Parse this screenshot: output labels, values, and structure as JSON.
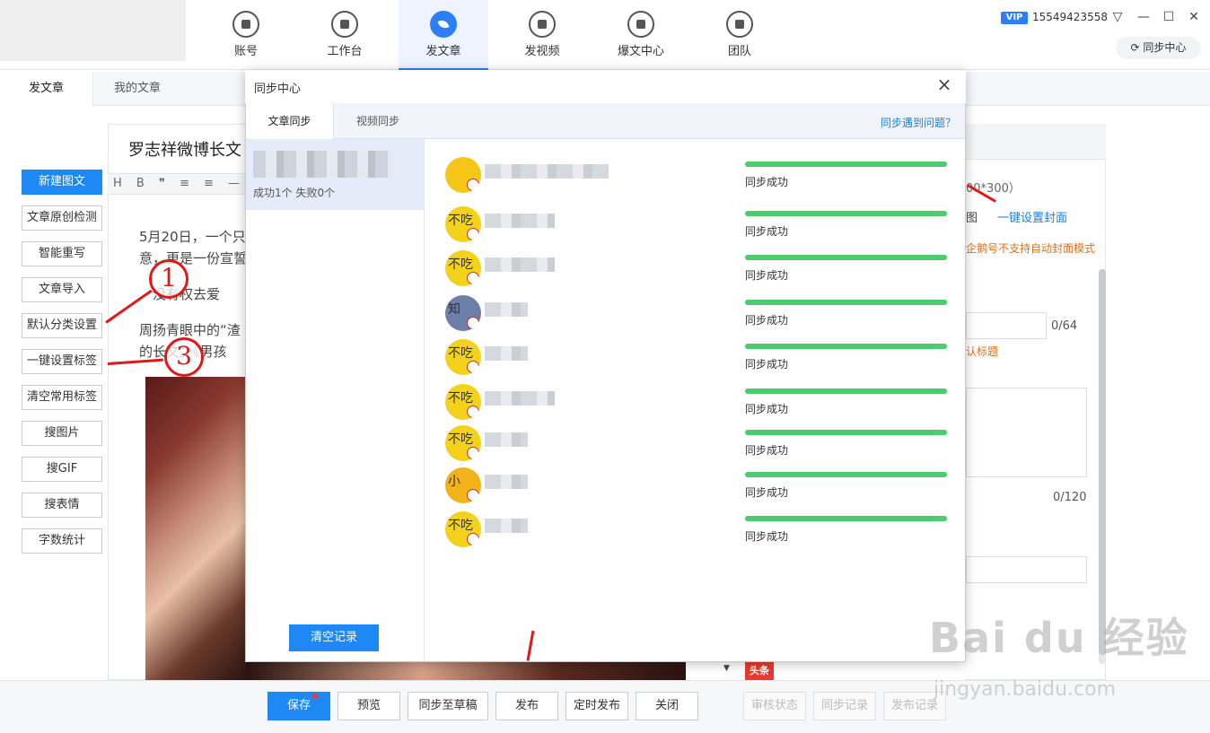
{
  "nav": {
    "items": [
      {
        "label": "账号",
        "icon": "account-icon"
      },
      {
        "label": "工作台",
        "icon": "monitor-icon"
      },
      {
        "label": "发文章",
        "icon": "feather-icon"
      },
      {
        "label": "发视频",
        "icon": "play-icon"
      },
      {
        "label": "爆文中心",
        "icon": "fire-icon"
      },
      {
        "label": "团队",
        "icon": "team-icon"
      }
    ],
    "active": "发文章"
  },
  "user": {
    "vip": "VIP",
    "phone": "15549423558",
    "sync_center": "同步中心"
  },
  "page_tabs": [
    "发文章",
    "我的文章"
  ],
  "tools": [
    "新建图文",
    "文章原创检测",
    "智能重写",
    "文章导入",
    "默认分类设置",
    "一键设置标签",
    "清空常用标签",
    "搜图片",
    "搜GIF",
    "搜表情",
    "字数统计"
  ],
  "editor": {
    "title": "罗志祥微博长文",
    "toolbar": "H B ❞ ≡ ≡ —",
    "paragraphs": [
      "5月20日，一个只",
      "意，更是一份宣誓",
      "没有权去爱",
      "周扬青眼中的“渣",
      "的长文。《男孩"
    ]
  },
  "right_panel": {
    "cover_size": "00*300）",
    "image_label": "图",
    "cover_link": "一键设置封面",
    "cover_tip": "企鹅号不支持自动封面模式",
    "title_count": "0/64",
    "title_tip": "认标题",
    "abstract_count": "0/120"
  },
  "bottom": {
    "buttons": [
      "保存",
      "预览",
      "同步至草稿",
      "发布",
      "定时发布",
      "关闭"
    ],
    "disabled_buttons": [
      "审核状态",
      "同步记录",
      "发布记录"
    ],
    "platform_badge": "头条"
  },
  "modal": {
    "title": "同步中心",
    "close": "×",
    "tabs": [
      "文章同步",
      "视频同步"
    ],
    "help_link": "同步遇到问题？",
    "record_stat": "成功1个 失败0个",
    "clear_button": "清空记录",
    "rows": [
      {
        "avatar_text": "",
        "avatar_color": "#f5c518",
        "status": "同步成功",
        "progress": 1.0
      },
      {
        "avatar_text": "不吃",
        "avatar_color": "#f4d21c",
        "status": "同步成功",
        "progress": 1.0
      },
      {
        "avatar_text": "不吃",
        "avatar_color": "#f4d21c",
        "status": "同步成功",
        "progress": 1.0
      },
      {
        "avatar_text": "知",
        "avatar_color": "#6b7fa8",
        "status": "同步成功",
        "progress": 1.0
      },
      {
        "avatar_text": "不吃",
        "avatar_color": "#f4d21c",
        "status": "同步成功",
        "progress": 1.0
      },
      {
        "avatar_text": "不吃",
        "avatar_color": "#f4d21c",
        "status": "同步成功",
        "progress": 1.0
      },
      {
        "avatar_text": "不吃",
        "avatar_color": "#f4d21c",
        "status": "同步成功",
        "progress": 1.0
      },
      {
        "avatar_text": "小",
        "avatar_color": "#f2b21a",
        "status": "同步成功",
        "progress": 1.0
      },
      {
        "avatar_text": "不吃",
        "avatar_color": "#f4d21c",
        "status": "同步成功",
        "progress": 1.0
      }
    ]
  },
  "annotations": [
    "1",
    "3"
  ],
  "watermark": {
    "logo": "Bai du 经验",
    "url": "jingyan.baidu.com"
  }
}
